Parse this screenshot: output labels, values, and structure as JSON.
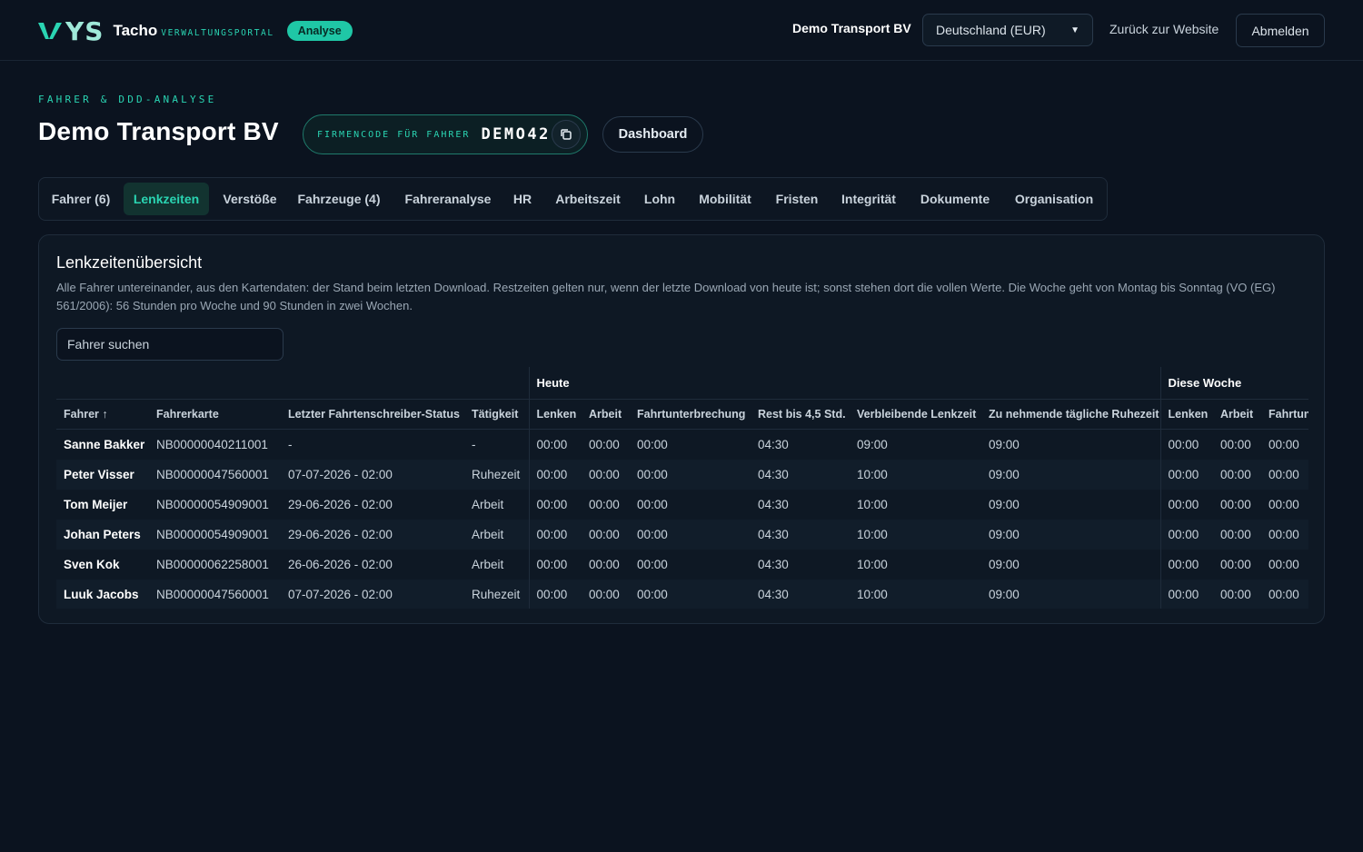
{
  "header": {
    "logo_mark": "YS",
    "logo_name": "Tacho",
    "logo_sub": "VERWALTUNGSPORTAL",
    "badge": "Analyse",
    "company": "Demo Transport BV",
    "country": "Deutschland (EUR)",
    "back_link": "Zurück zur Website",
    "logout": "Abmelden"
  },
  "page": {
    "eyebrow": "FAHRER & DDD-ANALYSE",
    "title": "Demo Transport BV",
    "code_label": "FIRMENCODE FÜR FAHRER",
    "code_value": "DEMO42",
    "dashboard": "Dashboard"
  },
  "tabs": [
    {
      "label": "Fahrer (6)"
    },
    {
      "label": "Lenkzeiten",
      "active": true
    },
    {
      "label": "Verstöße"
    },
    {
      "label": "Fahrzeuge (4)"
    },
    {
      "label": "Fahreranalyse"
    },
    {
      "label": "HR"
    },
    {
      "label": "Arbeitszeit"
    },
    {
      "label": "Lohn"
    },
    {
      "label": "Mobilität"
    },
    {
      "label": "Fristen"
    },
    {
      "label": "Integrität"
    },
    {
      "label": "Dokumente"
    },
    {
      "label": "Organisation"
    }
  ],
  "card": {
    "title": "Lenkzeitenübersicht",
    "description": "Alle Fahrer untereinander, aus den Kartendaten: der Stand beim letzten Download. Restzeiten gelten nur, wenn der letzte Download von heute ist; sonst stehen dort die vollen Werte. Die Woche geht von Montag bis Sonntag (VO (EG) 561/2006): 56 Stunden pro Woche und 90 Stunden in zwei Wochen.",
    "search_placeholder": "Fahrer suchen"
  },
  "table": {
    "group_today": "Heute",
    "group_week": "Diese Woche",
    "columns": [
      "Fahrer ↑",
      "Fahrerkarte",
      "Letzter Fahrtenschreiber-Status",
      "Tätigkeit",
      "Lenken",
      "Arbeit",
      "Fahrtunterbrechung",
      "Rest bis 4,5 Std.",
      "Verbleibende Lenkzeit",
      "Zu nehmende tägliche Ruhezeit",
      "Lenken",
      "Arbeit",
      "Fahrtunterbrechung"
    ],
    "rows": [
      [
        "Sanne Bakker",
        "NB00000040211001",
        "-",
        "-",
        "00:00",
        "00:00",
        "00:00",
        "04:30",
        "09:00",
        "09:00",
        "00:00",
        "00:00",
        "00:00"
      ],
      [
        "Peter Visser",
        "NB00000047560001",
        "07-07-2026 - 02:00",
        "Ruhezeit",
        "00:00",
        "00:00",
        "00:00",
        "04:30",
        "10:00",
        "09:00",
        "00:00",
        "00:00",
        "00:00"
      ],
      [
        "Tom Meijer",
        "NB00000054909001",
        "29-06-2026 - 02:00",
        "Arbeit",
        "00:00",
        "00:00",
        "00:00",
        "04:30",
        "10:00",
        "09:00",
        "00:00",
        "00:00",
        "00:00"
      ],
      [
        "Johan Peters",
        "NB00000054909001",
        "29-06-2026 - 02:00",
        "Arbeit",
        "00:00",
        "00:00",
        "00:00",
        "04:30",
        "10:00",
        "09:00",
        "00:00",
        "00:00",
        "00:00"
      ],
      [
        "Sven Kok",
        "NB00000062258001",
        "26-06-2026 - 02:00",
        "Arbeit",
        "00:00",
        "00:00",
        "00:00",
        "04:30",
        "10:00",
        "09:00",
        "00:00",
        "00:00",
        "00:00"
      ],
      [
        "Luuk Jacobs",
        "NB00000047560001",
        "07-07-2026 - 02:00",
        "Ruhezeit",
        "00:00",
        "00:00",
        "00:00",
        "04:30",
        "10:00",
        "09:00",
        "00:00",
        "00:00",
        "00:00"
      ]
    ]
  },
  "colors": {
    "accent": "#2ad4b2",
    "background": "#0b131f",
    "card": "#0e1824"
  }
}
